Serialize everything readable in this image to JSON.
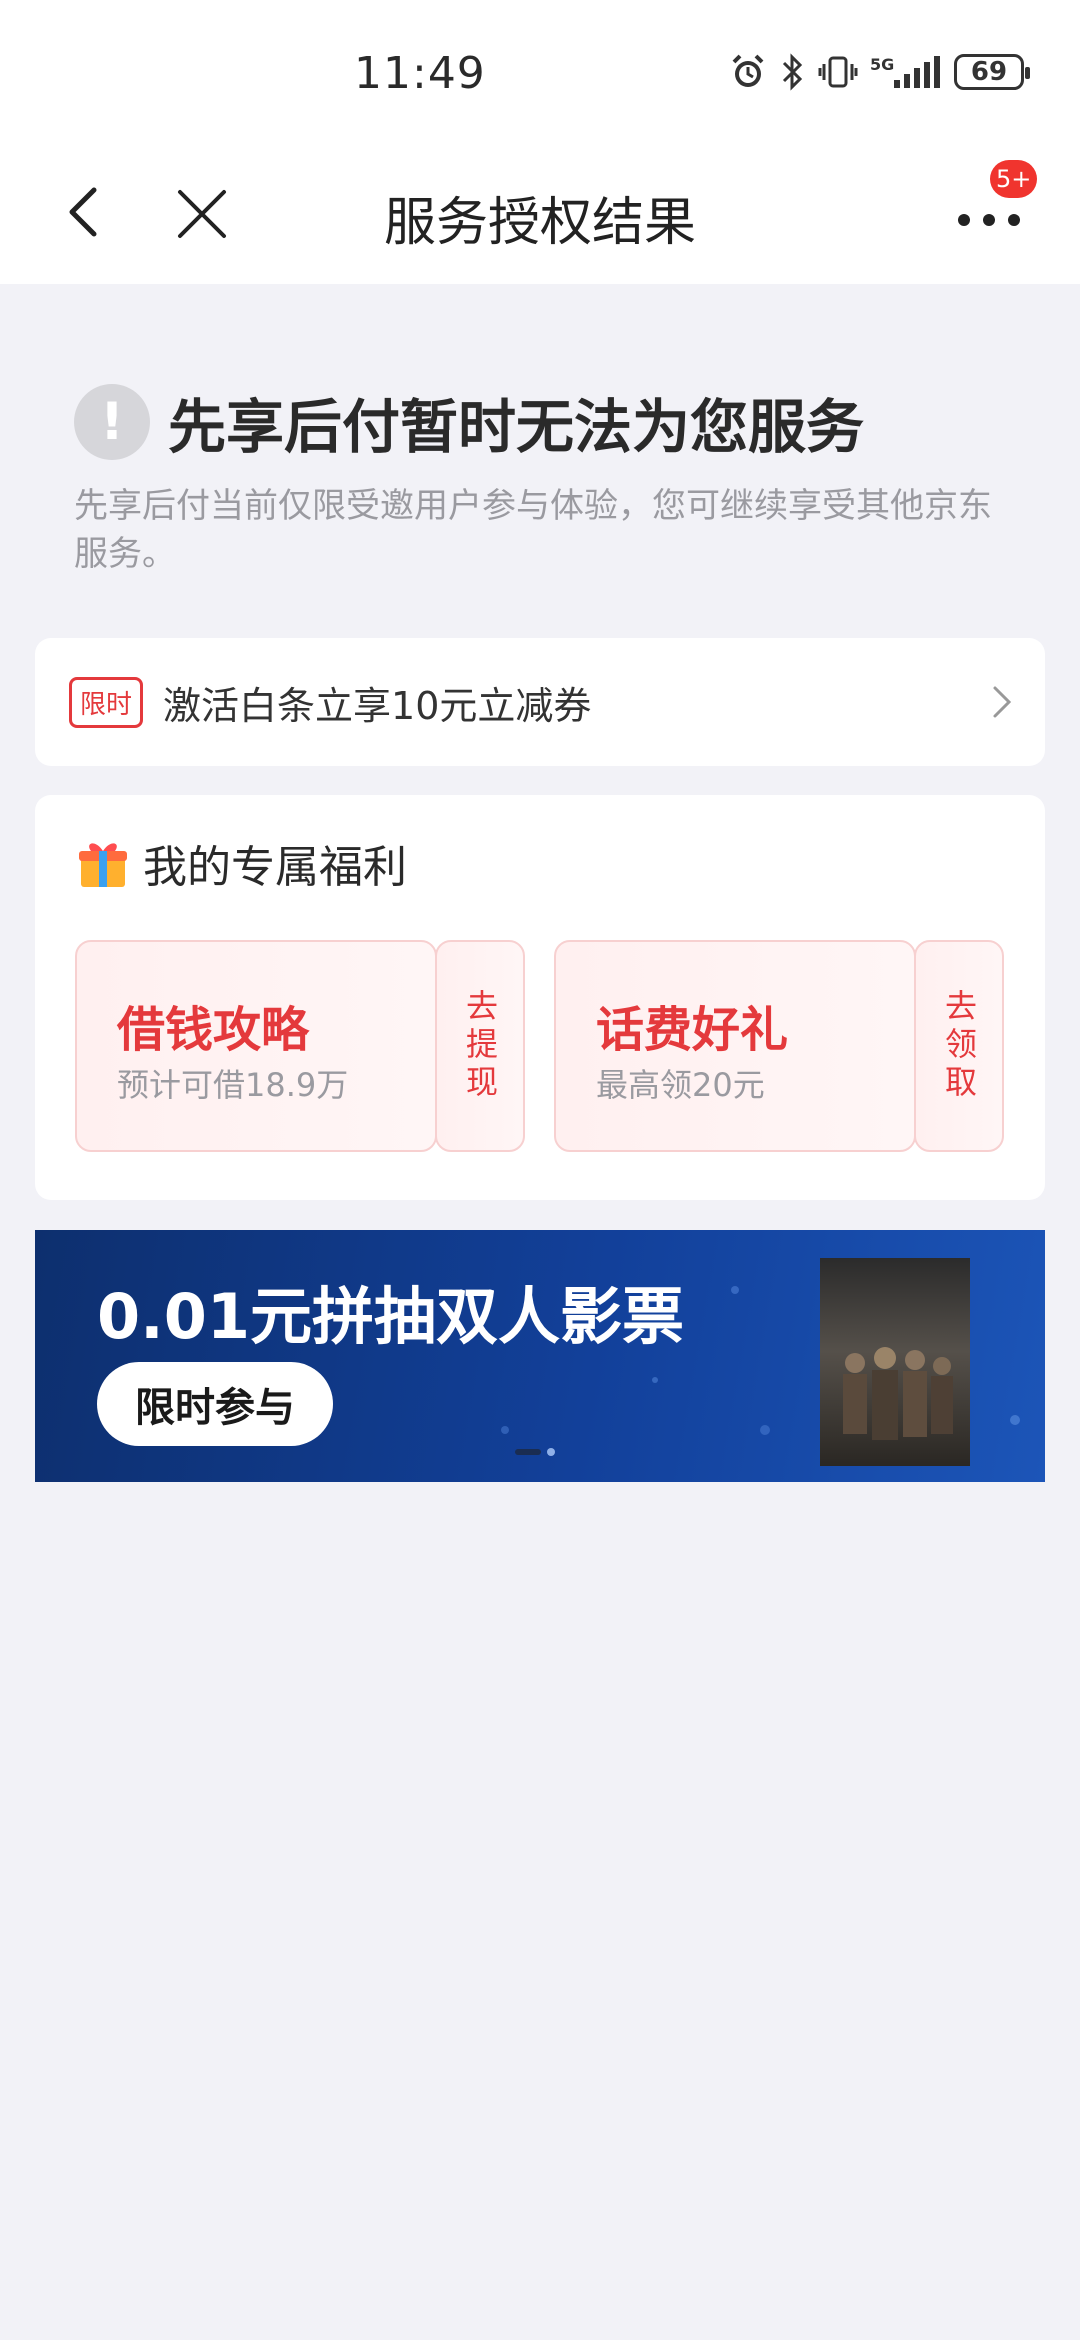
{
  "status_bar": {
    "time": "11:49",
    "network": "5G",
    "battery": "69"
  },
  "nav": {
    "title": "服务授权结果",
    "badge": "5+"
  },
  "result": {
    "title": "先享后付暂时无法为您服务",
    "description": "先享后付当前仅限受邀用户参与体验，您可继续享受其他京东服务。"
  },
  "promo": {
    "tag": "限时",
    "text": "激活白条立享10元立减券"
  },
  "benefits": {
    "title": "我的专属福利",
    "items": [
      {
        "title": "借钱攻略",
        "subtitle": "预计可借18.9万",
        "action": "去提现"
      },
      {
        "title": "话费好礼",
        "subtitle": "最高领20元",
        "action": "去领取"
      }
    ]
  },
  "banner": {
    "title": "0.01元拼抽双人影票",
    "button": "限时参与"
  },
  "colors": {
    "accent": "#e4393c",
    "background": "#f2f2f7",
    "banner": "#12409a"
  }
}
